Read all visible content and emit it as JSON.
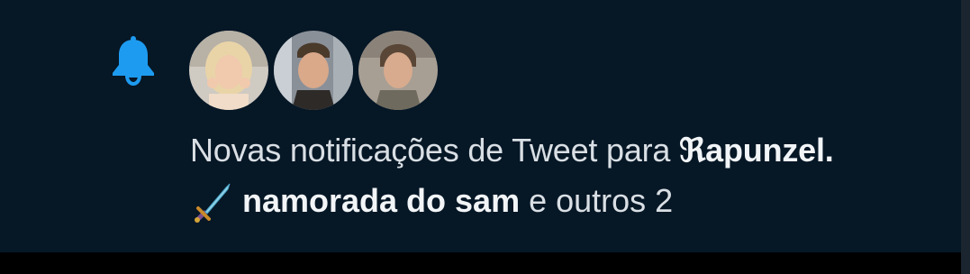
{
  "notification": {
    "icon": "bell-icon",
    "accent_color": "#1d9bf0",
    "avatars": [
      {
        "name": "avatar-blonde-woman-icon"
      },
      {
        "name": "avatar-man-icon"
      },
      {
        "name": "avatar-man-icon"
      }
    ],
    "message_prefix": "Novas notificações de Tweet para ",
    "user_display_first": "ℜ",
    "user_display_rest": "apunzel.",
    "user_emoji": "dagger-icon",
    "second_user_name": "namorada do sam",
    "others_text": "e outros 2"
  }
}
